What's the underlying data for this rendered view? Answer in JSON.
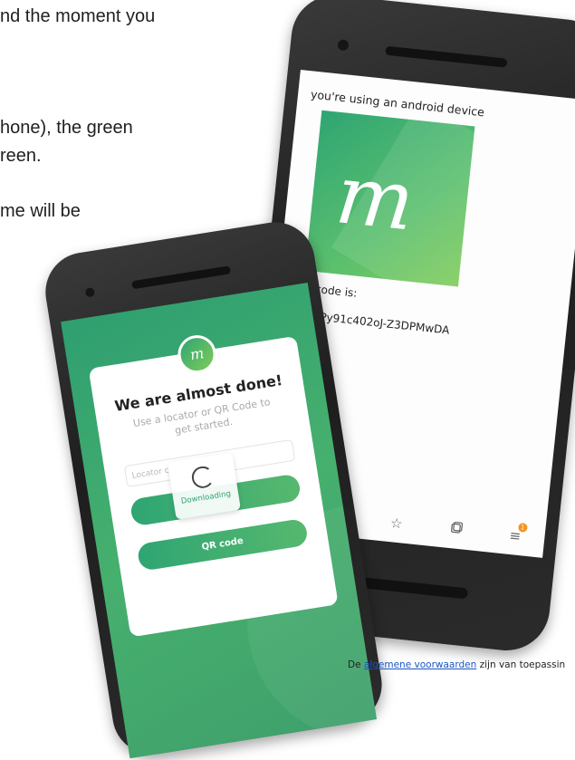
{
  "document": {
    "lines": [
      "nd the moment you",
      "hone), the green",
      "reen.",
      "me will be"
    ],
    "footer": {
      "prefix": "De ",
      "link": "algemene voorwaarden",
      "suffix": " zijn van toepassin"
    }
  },
  "right_phone": {
    "device_text": "you're using an android device",
    "logo_glyph": "m",
    "code_label": "Your code is:",
    "code_value": "gl-e9pPy91c402oJ-Z3DPMwDA",
    "nav_icons": [
      "chevron-right-icon",
      "home-icon",
      "star-icon",
      "tabs-icon",
      "menu-icon"
    ],
    "badge_count": "1"
  },
  "left_phone": {
    "title": "We are almost done!",
    "subtitle": "Use a locator or QR Code to get started.",
    "locator_placeholder": "Locator c",
    "downloading_label": "Downloading",
    "qr_button": "QR code"
  },
  "colors": {
    "brand_green": "#2fa573",
    "brand_light_green": "#7fcc5a",
    "badge_orange": "#f7941d",
    "link_blue": "#1a56c2"
  }
}
